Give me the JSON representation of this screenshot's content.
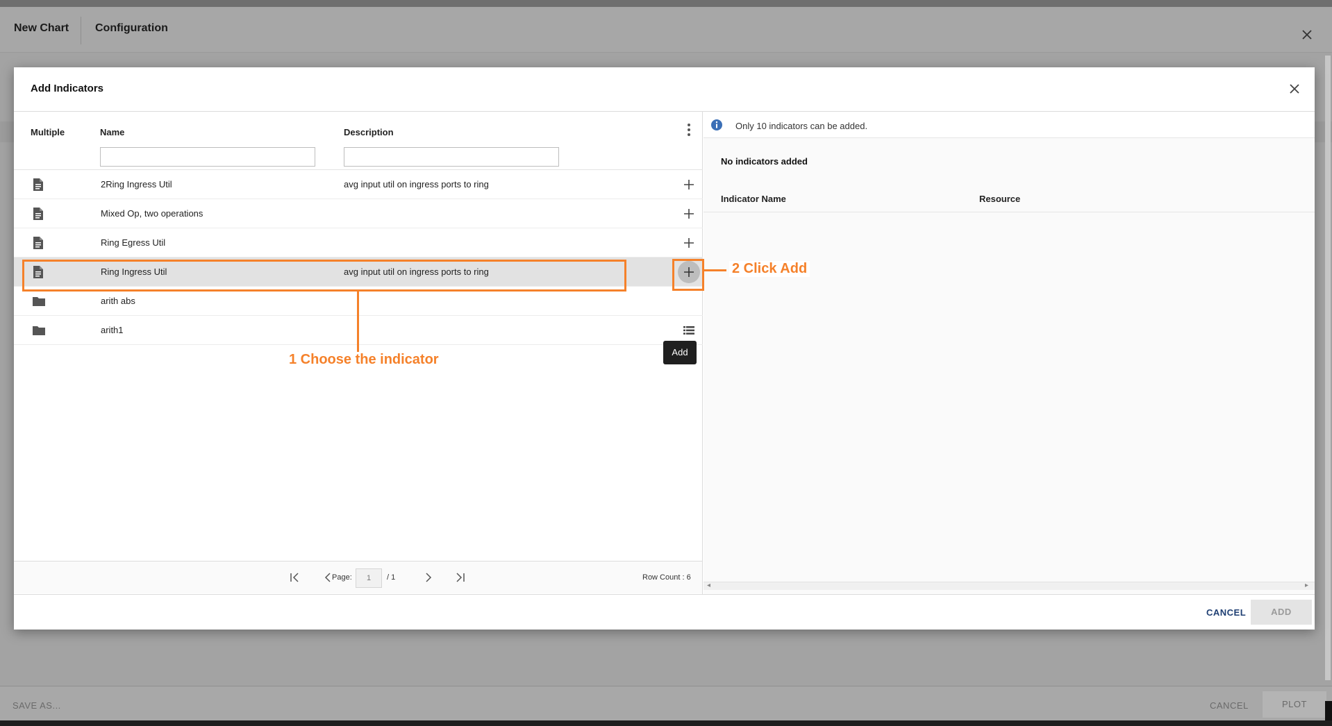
{
  "app": {
    "title": "New Chart",
    "tab": "Configuration",
    "footer": {
      "save_as": "SAVE AS...",
      "cancel": "CANCEL",
      "plot": "PLOT"
    }
  },
  "dialog": {
    "title": "Add Indicators",
    "columns": {
      "multiple": "Multiple",
      "name": "Name",
      "description": "Description"
    },
    "filters": {
      "name_value": "",
      "description_value": ""
    },
    "rows": [
      {
        "icon": "file-icon",
        "name": "2Ring Ingress Util",
        "description": "avg input util on ingress ports to ring",
        "action": "plus-icon",
        "selected": false
      },
      {
        "icon": "file-icon",
        "name": "Mixed Op, two operations",
        "description": "",
        "action": "plus-icon",
        "selected": false
      },
      {
        "icon": "file-icon",
        "name": "Ring Egress Util",
        "description": "",
        "action": "plus-icon",
        "selected": false
      },
      {
        "icon": "file-icon",
        "name": "Ring Ingress Util",
        "description": "avg input util on ingress ports to ring",
        "action": "plus-icon",
        "selected": true
      },
      {
        "icon": "folder-icon",
        "name": "arith abs",
        "description": "",
        "action": "",
        "selected": false
      },
      {
        "icon": "folder-icon",
        "name": "arith1",
        "description": "",
        "action": "list-icon",
        "selected": false
      }
    ],
    "tooltip": "Add",
    "pagination": {
      "page_label": "Page:",
      "page": "1",
      "total": "/ 1",
      "row_count": "Row Count : 6"
    },
    "right": {
      "info": "Only 10 indicators can be added.",
      "empty": "No indicators added",
      "columns": {
        "indicator_name": "Indicator Name",
        "resource": "Resource"
      }
    },
    "buttons": {
      "cancel": "CANCEL",
      "add": "ADD"
    }
  },
  "annotations": {
    "step1": "1 Choose the indicator",
    "step2": "2 Click Add"
  },
  "colors": {
    "annotation": "#f5812a",
    "link": "#1f3f73",
    "info": "#3b6fb6"
  }
}
